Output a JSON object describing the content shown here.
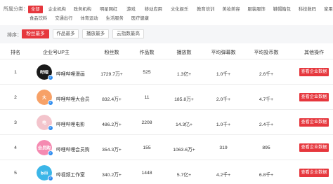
{
  "filter": {
    "label": "所属分类：",
    "categories_row1": [
      {
        "label": "全部",
        "active": true
      },
      {
        "label": "企业机构",
        "active": false
      },
      {
        "label": "政务机构",
        "active": false
      },
      {
        "label": "明星网红",
        "active": false
      },
      {
        "label": "游戏",
        "active": false
      },
      {
        "label": "移动应用",
        "active": false
      },
      {
        "label": "文化娱乐",
        "active": false
      },
      {
        "label": "教育培训",
        "active": false
      },
      {
        "label": "美妆美容",
        "active": false
      },
      {
        "label": "服装服饰",
        "active": false
      },
      {
        "label": "鞋帽箱包",
        "active": false
      },
      {
        "label": "科技数码",
        "active": false
      },
      {
        "label": "家用电器",
        "active": false
      }
    ],
    "categories_row2": [
      {
        "label": "食品饮料",
        "active": false
      },
      {
        "label": "交通出行",
        "active": false
      },
      {
        "label": "体育运动",
        "active": false
      },
      {
        "label": "生活服务",
        "active": false
      },
      {
        "label": "医疗健康",
        "active": false
      }
    ]
  },
  "sort": {
    "label": "排序：",
    "options": [
      {
        "label": "粉丝最多",
        "active": true
      },
      {
        "label": "作品最多",
        "active": false
      },
      {
        "label": "播放最多",
        "active": false
      },
      {
        "label": "云指数最高",
        "active": false
      }
    ]
  },
  "table": {
    "headers": {
      "rank": "排名",
      "account": "企业号UP主",
      "fans": "粉丝数",
      "works": "作品数",
      "plays": "播放数",
      "danmaku": "平均弹幕数",
      "coins": "平均投币数",
      "actions": "其他操作"
    },
    "rows": [
      {
        "rank": "1",
        "avatar_text": "哔哩",
        "avatar_color": "#1a1a1a",
        "name": "哔哩哔哩漫画",
        "fans": "1729.7万+",
        "works": "525",
        "plays": "1.3亿+",
        "danmaku": "1.0千+",
        "coins": "2.6千+",
        "action": "查看企业数据"
      },
      {
        "rank": "2",
        "avatar_text": "大",
        "avatar_color": "#f7a167",
        "name": "哔哩哔哩大会员",
        "fans": "832.4万+",
        "works": "11",
        "plays": "185.8万+",
        "danmaku": "2.0千+",
        "coins": "4.7千+",
        "action": "查看企业数据"
      },
      {
        "rank": "3",
        "avatar_text": "电",
        "avatar_color": "#f3c4cc",
        "name": "哔哩哔哩电影",
        "fans": "486.2万+",
        "works": "2208",
        "plays": "14.3亿+",
        "danmaku": "1.0千+",
        "coins": "2.4千+",
        "action": "查看企业数据"
      },
      {
        "rank": "4",
        "avatar_text": "会员购",
        "avatar_color": "#f58ab1",
        "name": "哔哩哔哩会员购",
        "fans": "354.3万+",
        "works": "155",
        "plays": "1063.6万+",
        "danmaku": "319",
        "coins": "895",
        "action": "查看企业数据"
      },
      {
        "rank": "5",
        "avatar_text": "bili",
        "avatar_color": "#3bb6e8",
        "name": "哔视频工作室",
        "fans": "340.2万+",
        "works": "1448",
        "plays": "5.7亿+",
        "danmaku": "4.2千+",
        "coins": "6.8千+",
        "action": "查看企业数据"
      }
    ]
  },
  "colors": {
    "accent": "#e6373d",
    "verify_badge": "#2d8cf0",
    "sort_bar_bg": "#f5f6f8"
  }
}
